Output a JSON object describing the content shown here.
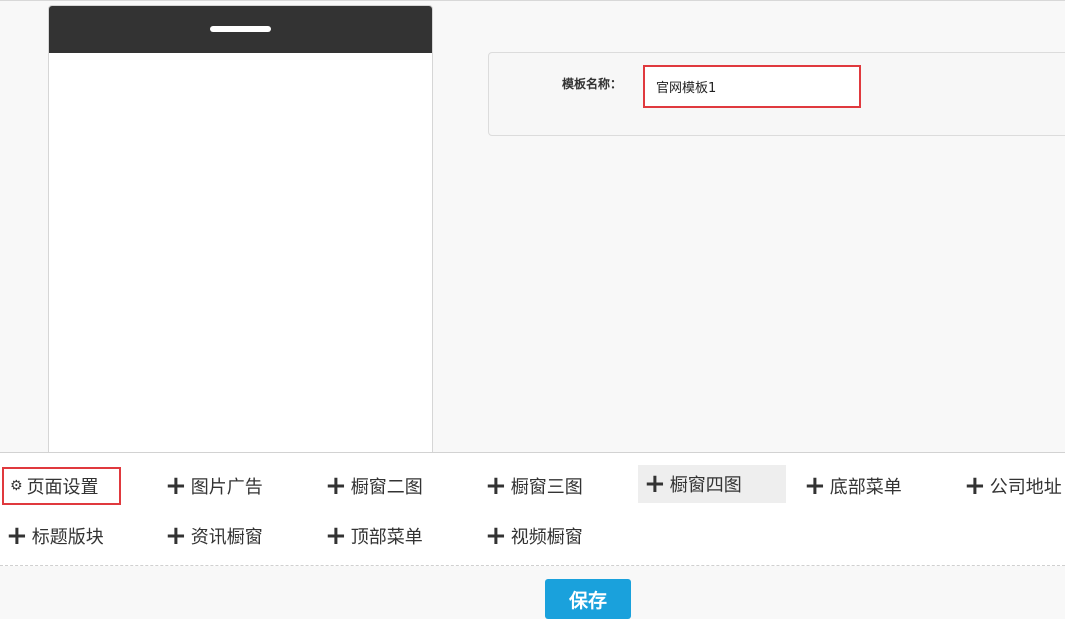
{
  "phone_preview": {},
  "form": {
    "label": "模板名称：",
    "template_name_value": "官网模板1"
  },
  "toolbar": {
    "page_settings": "页面设置",
    "row1": [
      "图片广告",
      "橱窗二图",
      "橱窗三图",
      "橱窗四图",
      "底部菜单",
      "公司地址"
    ],
    "row2": [
      "标题版块",
      "资讯橱窗",
      "顶部菜单",
      "视频橱窗"
    ]
  },
  "footer": {
    "save_label": "保存"
  },
  "colors": {
    "accent": "#1aa1dc",
    "highlight": "#e0393e",
    "phone_header": "#333333"
  }
}
